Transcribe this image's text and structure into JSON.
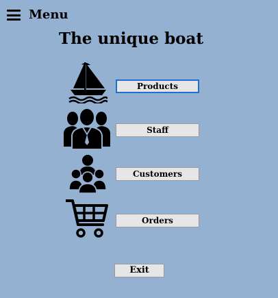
{
  "header": {
    "menu_icon": "hamburger-icon",
    "menu_label": "Menu"
  },
  "title": "The unique boat",
  "nav": {
    "products": {
      "icon": "sailboat-icon",
      "label": "Products"
    },
    "staff": {
      "icon": "staff-group-icon",
      "label": "Staff"
    },
    "customers": {
      "icon": "customers-group-icon",
      "label": "Customers"
    },
    "orders": {
      "icon": "shopping-cart-icon",
      "label": "Orders"
    }
  },
  "exit_label": "Exit",
  "colors": {
    "background": "#94b1d1",
    "button_face": "#e6e6e6",
    "focus_border": "#1e6fd0"
  }
}
